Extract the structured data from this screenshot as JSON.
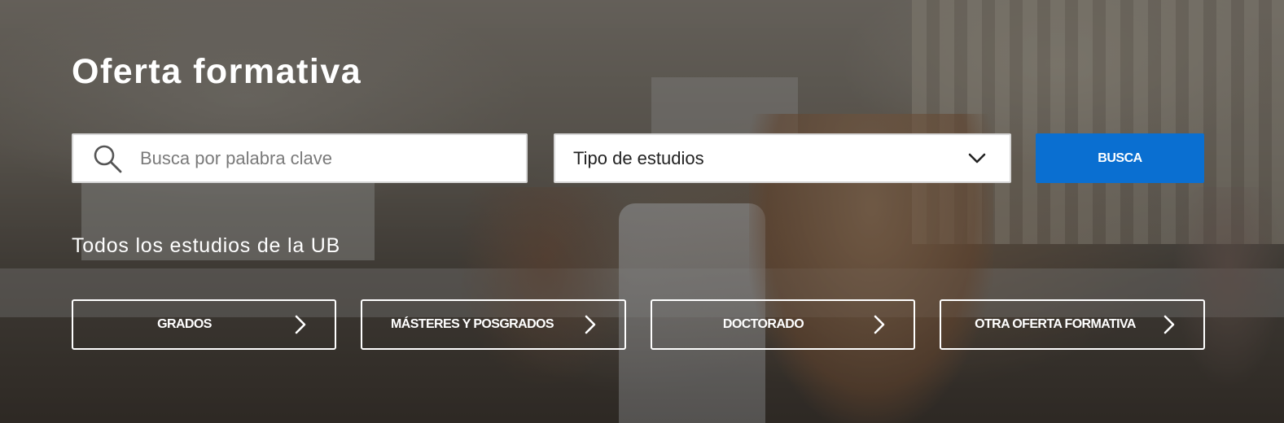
{
  "header": {
    "title": "Oferta formativa"
  },
  "search": {
    "placeholder": "Busca por palabra clave",
    "value": "",
    "icon": "search-icon"
  },
  "study_type": {
    "selected": "Tipo de estudios",
    "icon": "chevron-down-icon"
  },
  "search_button": {
    "label": "BUSCA",
    "color": "#0a6fd1"
  },
  "section": {
    "subtitle": "Todos los estudios de la UB"
  },
  "categories": [
    {
      "label": "GRADOS",
      "icon": "chevron-right-icon"
    },
    {
      "label": "MÁSTERES Y POSGRADOS",
      "icon": "chevron-right-icon"
    },
    {
      "label": "DOCTORADO",
      "icon": "chevron-right-icon"
    },
    {
      "label": "OTRA OFERTA FORMATIVA",
      "icon": "chevron-right-icon"
    }
  ]
}
